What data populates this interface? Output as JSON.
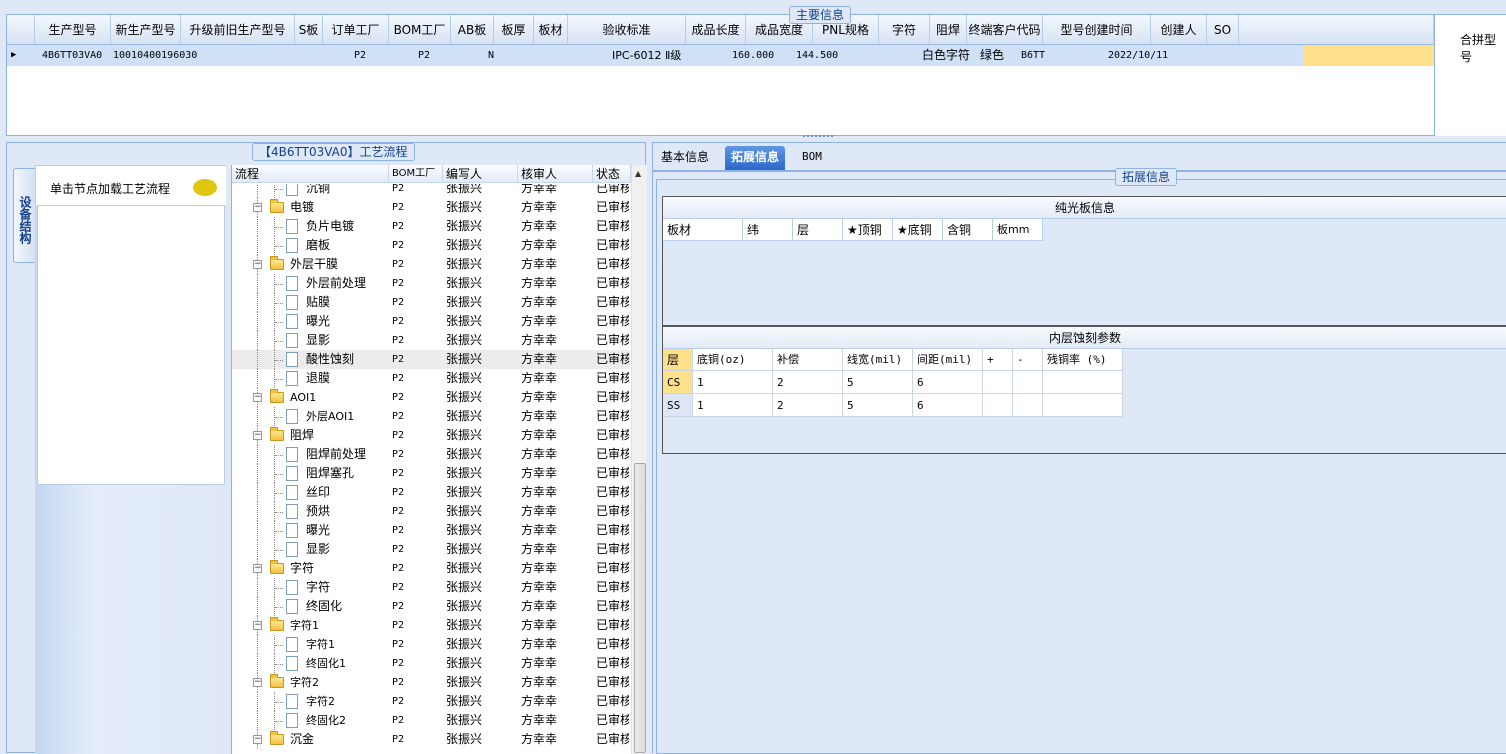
{
  "main_info": {
    "title": "主要信息",
    "columns": [
      "生产型号",
      "新生产型号",
      "升级前旧生产型号",
      "S板",
      "订单工厂",
      "BOM工厂",
      "AB板",
      "板厚",
      "板材",
      "验收标准",
      "成品长度",
      "成品宽度",
      "PNL规格",
      "字符",
      "阻焊",
      "终端客户代码",
      "型号创建时间",
      "创建人",
      "SO"
    ],
    "row": {
      "prod_model": "4B6TT03VA0",
      "new_model": "10010400196030",
      "order_factory": "P2",
      "bom_factory": "P2",
      "ab": "N",
      "standard": "IPC-6012 Ⅱ级",
      "length": "160.000",
      "width": "144.500",
      "char": "白色字符",
      "mask": "绿色",
      "customer": "B6TT",
      "created": "2022/10/11"
    },
    "merge_title": "合拼型号"
  },
  "left": {
    "vtab": "设备结构",
    "process_title": "【4B6TT03VA0】工艺流程",
    "node_hint": "单击节点加载工艺流程",
    "tree_headers": [
      "流程",
      "BOM工厂",
      "编写人",
      "核审人",
      "状态"
    ],
    "rows": [
      {
        "name": "沉铜",
        "level": 2,
        "factory": "P2",
        "writer": "张振兴",
        "reviewer": "方幸幸",
        "status": "已审核"
      },
      {
        "name": "电镀",
        "level": 1,
        "factory": "P2",
        "writer": "张振兴",
        "reviewer": "方幸幸",
        "status": "已审核"
      },
      {
        "name": "负片电镀",
        "level": 2,
        "factory": "P2",
        "writer": "张振兴",
        "reviewer": "方幸幸",
        "status": "已审核"
      },
      {
        "name": "磨板",
        "level": 2,
        "factory": "P2",
        "writer": "张振兴",
        "reviewer": "方幸幸",
        "status": "已审核"
      },
      {
        "name": "外层干膜",
        "level": 1,
        "factory": "P2",
        "writer": "张振兴",
        "reviewer": "方幸幸",
        "status": "已审核"
      },
      {
        "name": "外层前处理",
        "level": 2,
        "factory": "P2",
        "writer": "张振兴",
        "reviewer": "方幸幸",
        "status": "已审核"
      },
      {
        "name": "贴膜",
        "level": 2,
        "factory": "P2",
        "writer": "张振兴",
        "reviewer": "方幸幸",
        "status": "已审核"
      },
      {
        "name": "曝光",
        "level": 2,
        "factory": "P2",
        "writer": "张振兴",
        "reviewer": "方幸幸",
        "status": "已审核"
      },
      {
        "name": "显影",
        "level": 2,
        "factory": "P2",
        "writer": "张振兴",
        "reviewer": "方幸幸",
        "status": "已审核"
      },
      {
        "name": "酸性蚀刻",
        "level": 2,
        "factory": "P2",
        "writer": "张振兴",
        "reviewer": "方幸幸",
        "status": "已审核"
      },
      {
        "name": "退膜",
        "level": 2,
        "factory": "P2",
        "writer": "张振兴",
        "reviewer": "方幸幸",
        "status": "已审核"
      },
      {
        "name": "AOI1",
        "level": 1,
        "factory": "P2",
        "writer": "张振兴",
        "reviewer": "方幸幸",
        "status": "已审核"
      },
      {
        "name": "外层AOI1",
        "level": 2,
        "factory": "P2",
        "writer": "张振兴",
        "reviewer": "方幸幸",
        "status": "已审核"
      },
      {
        "name": "阻焊",
        "level": 1,
        "factory": "P2",
        "writer": "张振兴",
        "reviewer": "方幸幸",
        "status": "已审核"
      },
      {
        "name": "阻焊前处理",
        "level": 2,
        "factory": "P2",
        "writer": "张振兴",
        "reviewer": "方幸幸",
        "status": "已审核"
      },
      {
        "name": "阻焊塞孔",
        "level": 2,
        "factory": "P2",
        "writer": "张振兴",
        "reviewer": "方幸幸",
        "status": "已审核"
      },
      {
        "name": "丝印",
        "level": 2,
        "factory": "P2",
        "writer": "张振兴",
        "reviewer": "方幸幸",
        "status": "已审核"
      },
      {
        "name": "预烘",
        "level": 2,
        "factory": "P2",
        "writer": "张振兴",
        "reviewer": "方幸幸",
        "status": "已审核"
      },
      {
        "name": "曝光",
        "level": 2,
        "factory": "P2",
        "writer": "张振兴",
        "reviewer": "方幸幸",
        "status": "已审核"
      },
      {
        "name": "显影",
        "level": 2,
        "factory": "P2",
        "writer": "张振兴",
        "reviewer": "方幸幸",
        "status": "已审核"
      },
      {
        "name": "字符",
        "level": 1,
        "factory": "P2",
        "writer": "张振兴",
        "reviewer": "方幸幸",
        "status": "已审核"
      },
      {
        "name": "字符",
        "level": 2,
        "factory": "P2",
        "writer": "张振兴",
        "reviewer": "方幸幸",
        "status": "已审核"
      },
      {
        "name": "终固化",
        "level": 2,
        "factory": "P2",
        "writer": "张振兴",
        "reviewer": "方幸幸",
        "status": "已审核"
      },
      {
        "name": "字符1",
        "level": 1,
        "factory": "P2",
        "writer": "张振兴",
        "reviewer": "方幸幸",
        "status": "已审核"
      },
      {
        "name": "字符1",
        "level": 2,
        "factory": "P2",
        "writer": "张振兴",
        "reviewer": "方幸幸",
        "status": "已审核"
      },
      {
        "name": "终固化1",
        "level": 2,
        "factory": "P2",
        "writer": "张振兴",
        "reviewer": "方幸幸",
        "status": "已审核"
      },
      {
        "name": "字符2",
        "level": 1,
        "factory": "P2",
        "writer": "张振兴",
        "reviewer": "方幸幸",
        "status": "已审核"
      },
      {
        "name": "字符2",
        "level": 2,
        "factory": "P2",
        "writer": "张振兴",
        "reviewer": "方幸幸",
        "status": "已审核"
      },
      {
        "name": "终固化2",
        "level": 2,
        "factory": "P2",
        "writer": "张振兴",
        "reviewer": "方幸幸",
        "status": "已审核"
      },
      {
        "name": "沉金",
        "level": 1,
        "factory": "P2",
        "writer": "张振兴",
        "reviewer": "方幸幸",
        "status": "已审核"
      }
    ]
  },
  "right": {
    "tabs": [
      "基本信息",
      "拓展信息",
      "BOM"
    ],
    "ext_title": "拓展信息",
    "sec1": {
      "title": "纯光板信息",
      "headers": [
        "板材",
        "纬",
        "层",
        "★顶铜",
        "★底铜",
        "含铜",
        "板mm"
      ]
    },
    "sec2": {
      "title": "内层蚀刻参数",
      "headers": [
        "层",
        "底铜(oz)",
        "补偿",
        "线宽(mil)",
        "间距(mil)",
        "+",
        "-",
        "残铜率 (%)"
      ],
      "rows": [
        [
          "CS",
          "1",
          "2",
          "5",
          "6",
          "",
          "",
          ""
        ],
        [
          "SS",
          "1",
          "2",
          "5",
          "6",
          "",
          "",
          ""
        ]
      ]
    }
  },
  "colors": {
    "selected_row": "#cfe0f7",
    "highlight_cell": "#ffe08a",
    "active_tab": "#2b68c8",
    "frame": "#8db2e3"
  }
}
